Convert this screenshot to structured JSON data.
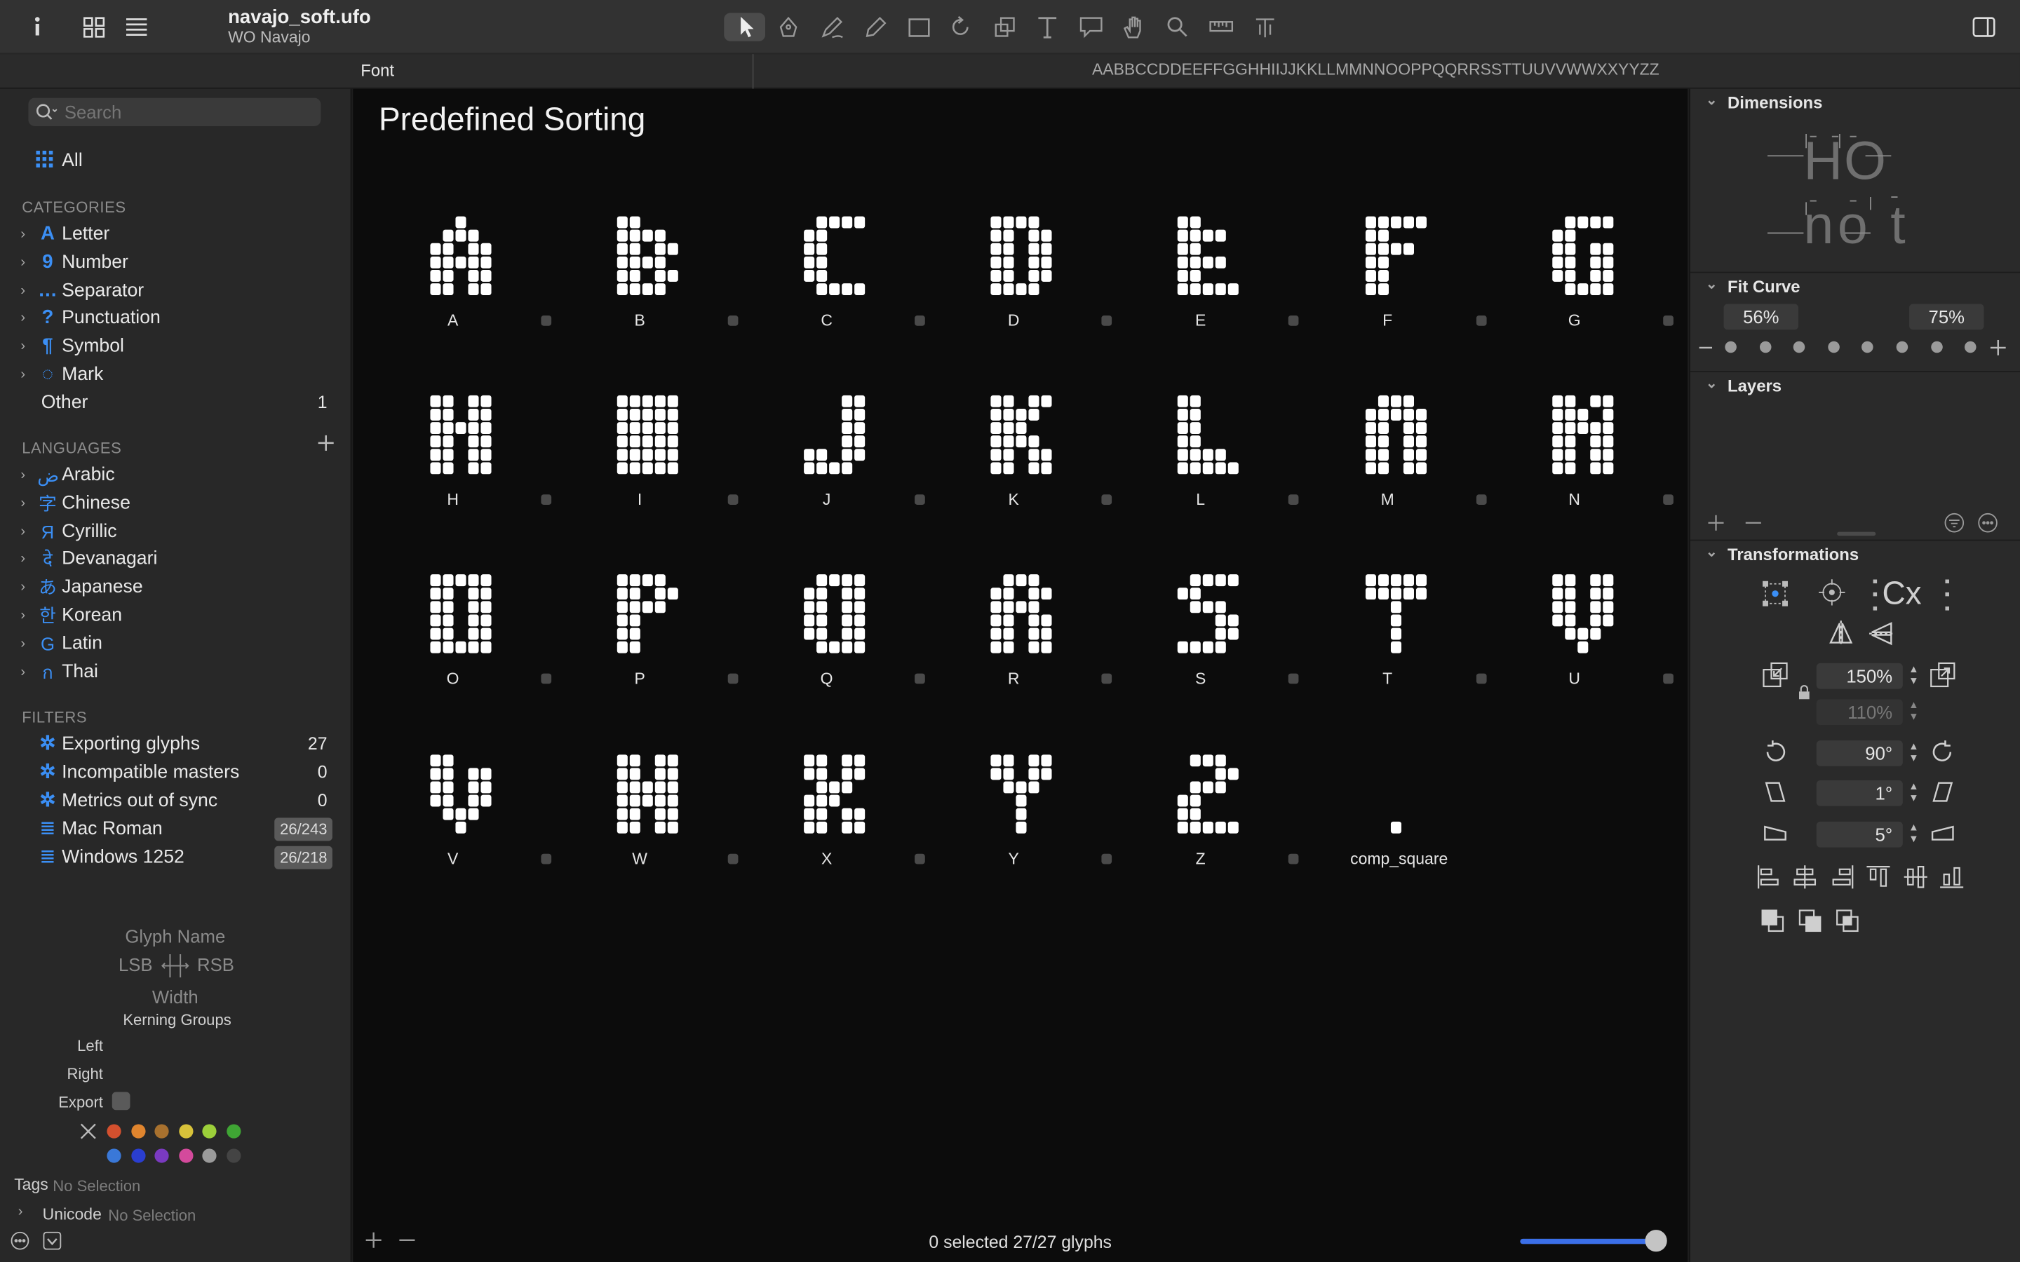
{
  "window": {
    "file_name": "navajo_soft.ufo",
    "family_name": "WO Navajo"
  },
  "toolbar": {
    "icons": [
      "info-icon",
      "grid-view-icon",
      "list-view-icon",
      "select-tool-icon",
      "pen-tool-icon",
      "draw-tool-icon",
      "pencil-tool-icon",
      "primitives-tool-icon",
      "rotate-tool-icon",
      "scale-tool-icon",
      "text-tool-icon",
      "annotation-tool-icon",
      "hand-tool-icon",
      "zoom-tool-icon",
      "measure-tool-icon",
      "knife-tool-icon",
      "sidebar-toggle-icon"
    ]
  },
  "tabbar": {
    "font_tab": "Font",
    "text_string": "AABBCCDDEEFFGGHHIIJJKKLLMMNNOOPPQQRRSSTTUUVVWWXXYYZZ"
  },
  "sidebar": {
    "search_placeholder": "Search",
    "all_label": "All",
    "categories_title": "CATEGORIES",
    "categories": [
      {
        "label": "Letter",
        "icon": "A"
      },
      {
        "label": "Number",
        "icon": "9"
      },
      {
        "label": "Separator",
        "icon": "…"
      },
      {
        "label": "Punctuation",
        "icon": "?"
      },
      {
        "label": "Symbol",
        "icon": "¶"
      },
      {
        "label": "Mark",
        "icon": "◌"
      }
    ],
    "other_label": "Other",
    "other_count": "1",
    "languages_title": "LANGUAGES",
    "languages": [
      {
        "label": "Arabic",
        "icon": "ض"
      },
      {
        "label": "Chinese",
        "icon": "字"
      },
      {
        "label": "Cyrillic",
        "icon": "Я"
      },
      {
        "label": "Devanagari",
        "icon": "दे"
      },
      {
        "label": "Japanese",
        "icon": "あ"
      },
      {
        "label": "Korean",
        "icon": "한"
      },
      {
        "label": "Latin",
        "icon": "G"
      },
      {
        "label": "Thai",
        "icon": "ก"
      }
    ],
    "filters_title": "FILTERS",
    "filters": [
      {
        "label": "Exporting glyphs",
        "count": "27"
      },
      {
        "label": "Incompatible masters",
        "count": "0"
      },
      {
        "label": "Metrics out of sync",
        "count": "0"
      }
    ],
    "lists": [
      {
        "label": "Mac Roman",
        "count": "26/243"
      },
      {
        "label": "Windows 1252",
        "count": "26/218"
      }
    ],
    "info": {
      "glyph_name": "Glyph Name",
      "lsb": "LSB",
      "rsb": "RSB",
      "width": "Width",
      "kerning_groups": "Kerning Groups",
      "left": "Left",
      "right": "Right",
      "export": "Export",
      "tags_label": "Tags",
      "tags_value": "No Selection",
      "unicode_label": "Unicode",
      "unicode_value": "No Selection"
    },
    "colors": [
      "#d4502e",
      "#e0852e",
      "#a8712e",
      "#d8c23a",
      "#9ccf3a",
      "#3fa534",
      "#3a78d8",
      "#2a3ed0",
      "#7a3ac0",
      "#d44a9c",
      "#9a9a9a",
      "#444444"
    ]
  },
  "main": {
    "title": "Predefined Sorting",
    "glyphs": [
      {
        "name": "A",
        "shape": [
          "..#..",
          ".###.",
          "##.##",
          "#####",
          "##.##",
          "##.##"
        ]
      },
      {
        "name": "B",
        "shape": [
          "##...",
          "####.",
          "##.##",
          "####.",
          "##.##",
          "####."
        ]
      },
      {
        "name": "C",
        "shape": [
          ".####",
          "##...",
          "##...",
          "##...",
          "##...",
          ".####"
        ]
      },
      {
        "name": "D",
        "shape": [
          "####.",
          "##.##",
          "##.##",
          "##.##",
          "##.##",
          "####."
        ]
      },
      {
        "name": "E",
        "shape": [
          "##...",
          "####.",
          "##...",
          "####.",
          "##...",
          "#####"
        ]
      },
      {
        "name": "F",
        "shape": [
          "#####",
          "##...",
          "####.",
          "##...",
          "##...",
          "##..."
        ]
      },
      {
        "name": "G",
        "shape": [
          ".####",
          "##...",
          "##.##",
          "##.##",
          "##.##",
          ".####"
        ]
      },
      {
        "name": "H",
        "shape": [
          "##.##",
          "##.##",
          "#####",
          "##.##",
          "##.##",
          "##.##"
        ]
      },
      {
        "name": "I",
        "shape": [
          "#####",
          "#####",
          "#####",
          "#####",
          "#####",
          "#####"
        ]
      },
      {
        "name": "J",
        "shape": [
          "...##",
          "...##",
          "...##",
          "...##",
          "##.##",
          "####."
        ]
      },
      {
        "name": "K",
        "shape": [
          "##.##",
          "####.",
          "###..",
          "####.",
          "##.##",
          "##.##"
        ]
      },
      {
        "name": "L",
        "shape": [
          "##...",
          "##...",
          "##...",
          "##...",
          "####.",
          "#####"
        ]
      },
      {
        "name": "M",
        "shape": [
          ".###.",
          "#####",
          "##.##",
          "##.##",
          "##.##",
          "##.##"
        ]
      },
      {
        "name": "N",
        "shape": [
          "##.##",
          "###.#",
          "#####",
          "##.##",
          "##.##",
          "##.##"
        ]
      },
      {
        "name": "O",
        "shape": [
          "#####",
          "##.##",
          "##.##",
          "##.##",
          "##.##",
          "#####"
        ]
      },
      {
        "name": "P",
        "shape": [
          "####.",
          "##.##",
          "####.",
          "##...",
          "##...",
          "##..."
        ]
      },
      {
        "name": "Q",
        "shape": [
          ".####",
          "##.##",
          "##.##",
          "##.##",
          "##.##",
          ".####"
        ]
      },
      {
        "name": "R",
        "shape": [
          ".###.",
          "##.##",
          "####.",
          "##.##",
          "##.##",
          "##.##"
        ]
      },
      {
        "name": "S",
        "shape": [
          ".####",
          "##...",
          ".###.",
          "...##",
          "...##",
          "####."
        ]
      },
      {
        "name": "T",
        "shape": [
          "#####",
          "#####",
          "..#..",
          "..#..",
          "..#..",
          "..#.."
        ]
      },
      {
        "name": "U",
        "shape": [
          "##.##",
          "##.##",
          "##.##",
          "##.##",
          ".###.",
          "..#.."
        ]
      },
      {
        "name": "V",
        "shape": [
          "##...",
          "##.##",
          "##.##",
          "##.##",
          ".###.",
          "..#.."
        ]
      },
      {
        "name": "W",
        "shape": [
          "##.##",
          "##.##",
          "#####",
          "#####",
          "##.##",
          "##.##"
        ]
      },
      {
        "name": "X",
        "shape": [
          "##.##",
          "##.##",
          ".###.",
          "###..",
          "##.##",
          "##.##"
        ]
      },
      {
        "name": "Y",
        "shape": [
          "##.##",
          "##.##",
          ".###.",
          "..#..",
          "..#..",
          "..#.."
        ]
      },
      {
        "name": "Z",
        "shape": [
          ".###.",
          "...##",
          ".###.",
          "##...",
          "##...",
          "#####"
        ]
      },
      {
        "name": "comp_square",
        "shape": [
          "",
          ".",
          "",
          ".",
          "",
          "..#.."
        ]
      }
    ],
    "status": "0 selected 27/27 glyphs",
    "zoom_slider_value": 1.0
  },
  "rpanel": {
    "dimensions_title": "Dimensions",
    "preview_line1": "HO",
    "preview_line2": "no t",
    "fit_curve_title": "Fit Curve",
    "fit_curve_min": "56%",
    "fit_curve_max": "75%",
    "layers_title": "Layers",
    "transformations_title": "Transformations",
    "cx_label": "Cx",
    "scale_x": "150%",
    "scale_y": "110%",
    "rotate": "90°",
    "slant": "1°",
    "skew": "5°"
  }
}
